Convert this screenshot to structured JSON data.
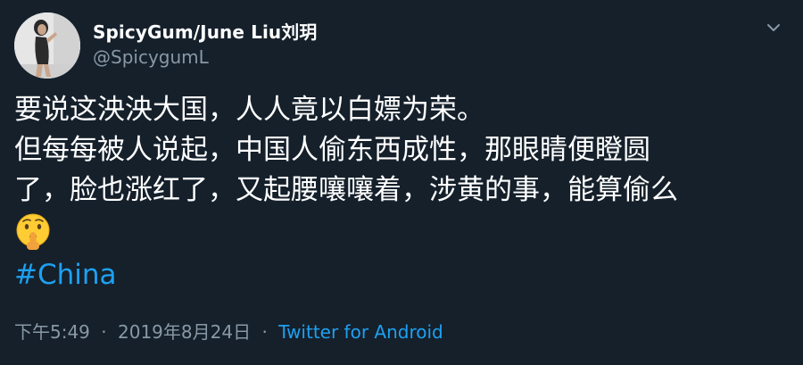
{
  "author": {
    "display_name": "SpicyGum/June Liu刘玥",
    "handle": "@SpicygumL"
  },
  "tweet": {
    "lines": [
      "要说这泱泱大国，人人竟以白嫖为荣。",
      "但每每被人说起，中国人偷东西成性，那眼睛便瞪圆",
      "了，脸也涨红了，又起腰嚷嚷着，涉黄的事，能算偷么"
    ],
    "emoji": "shushing-face",
    "hashtag": "#China"
  },
  "meta": {
    "time": "下午5:49",
    "separator": "·",
    "date": "2019年8月24日",
    "source": "Twitter for Android"
  },
  "icons": {
    "menu": "chevron-down-icon",
    "emoji": "shushing-face-emoji"
  },
  "colors": {
    "background": "#15202b",
    "text": "#ffffff",
    "secondary": "#8899a6",
    "accent": "#1da1f2"
  }
}
